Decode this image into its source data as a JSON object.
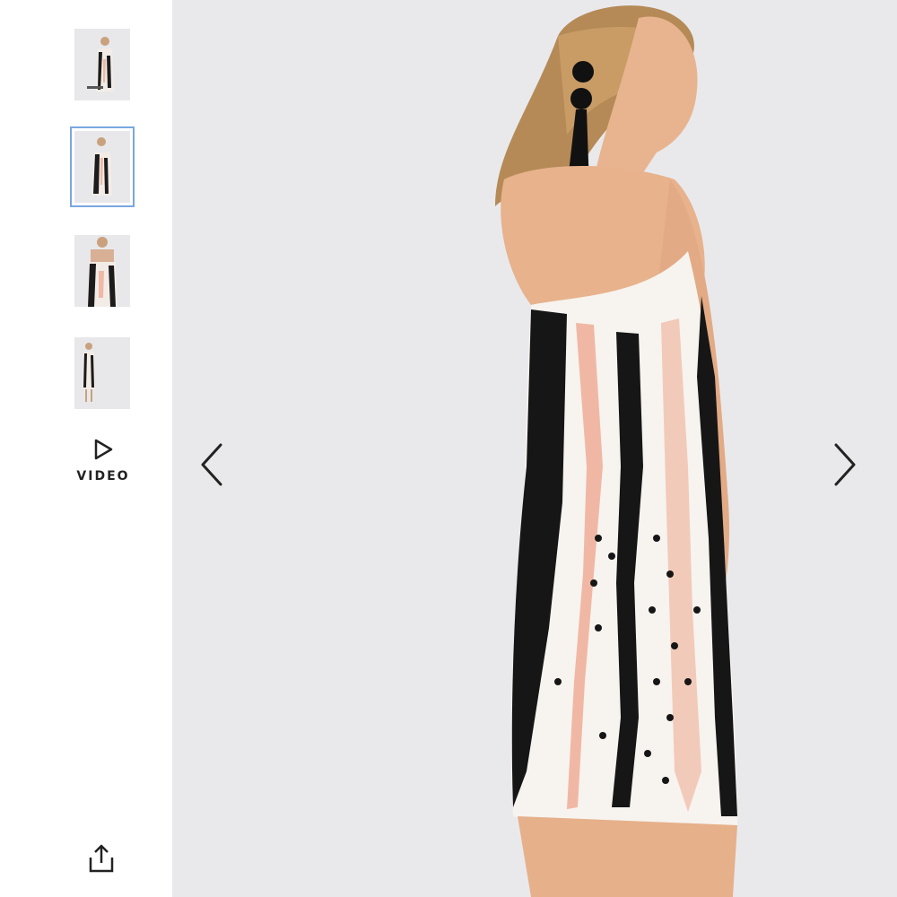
{
  "gallery": {
    "thumbnails": [
      {
        "name": "thumb-front-view",
        "active": false
      },
      {
        "name": "thumb-back-view",
        "active": true
      },
      {
        "name": "thumb-detail-view",
        "active": false
      },
      {
        "name": "thumb-full-view",
        "active": false
      }
    ],
    "video_label": "VIDEO",
    "icons": {
      "play": "play-icon",
      "share": "share-icon",
      "prev": "chevron-left-icon",
      "next": "chevron-right-icon"
    },
    "colors": {
      "active_outline": "#7aa7e0",
      "stage_background": "#e9e9ec"
    }
  }
}
